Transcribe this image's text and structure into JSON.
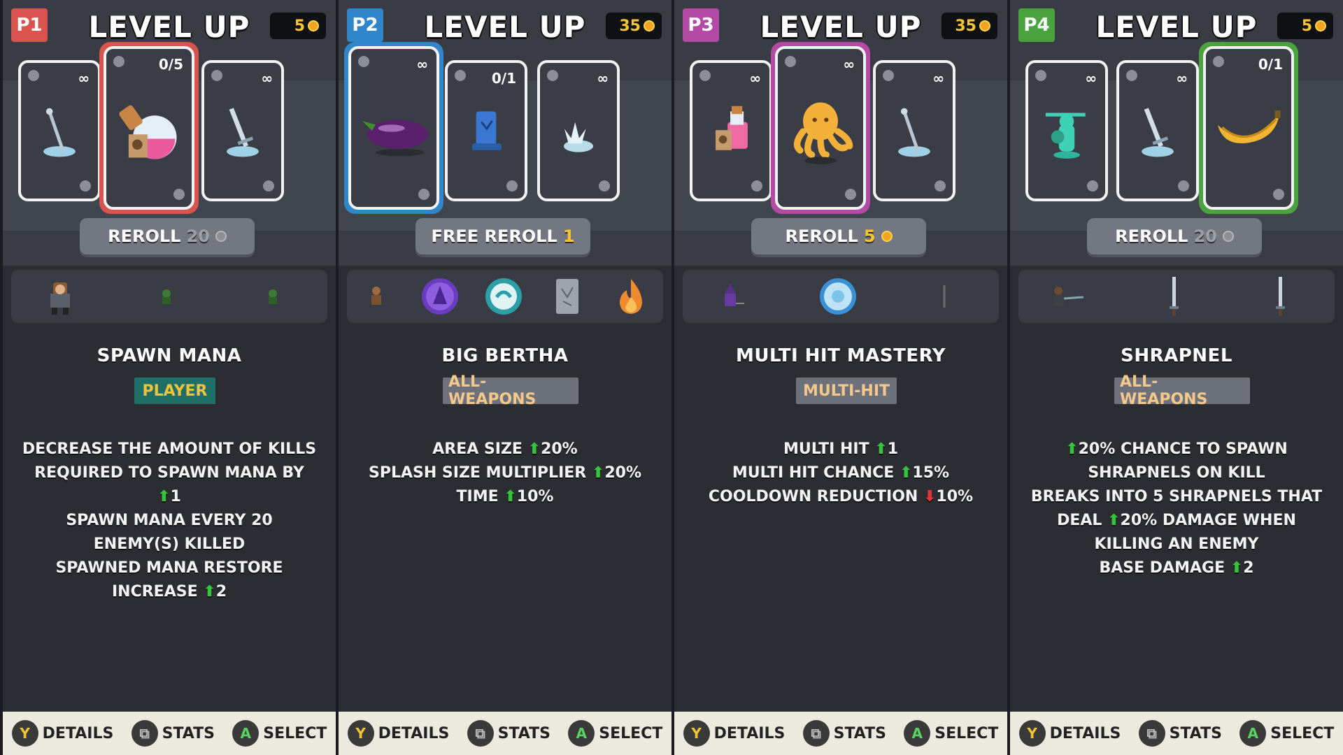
{
  "players": [
    {
      "badge": "P1",
      "badge_color": "#d9534f",
      "title": "LEVEL UP",
      "coins": "5",
      "cards": [
        {
          "qty": "∞",
          "icon": "staff-icon"
        },
        {
          "qty": "0/5",
          "icon": "mana-potion-icon",
          "selected": true
        },
        {
          "qty": "∞",
          "icon": "sword-icon"
        }
      ],
      "reroll_label": "REROLL",
      "reroll_cost": "20",
      "inventory": [
        "warrior-icon",
        "goblin-icon",
        "goblin-icon"
      ],
      "upgrade_name": "SPAWN MANA",
      "tag": "PLAYER",
      "tag_bg": "#1f6f68",
      "tag_color": "#f0c43a",
      "desc_lines": [
        "DECREASE THE AMOUNT OF KILLS",
        "REQUIRED TO SPAWN MANA BY",
        "↑1",
        "SPAWN MANA EVERY 20",
        "ENEMY(S) KILLED",
        "SPAWNED MANA RESTORE",
        "INCREASE ↑2"
      ],
      "hints": {
        "details": "DETAILS",
        "stats": "STATS",
        "select": "SELECT"
      }
    },
    {
      "badge": "P2",
      "badge_color": "#2f86c8",
      "title": "LEVEL UP",
      "coins": "35",
      "cards": [
        {
          "qty": "∞",
          "icon": "eggplant-icon",
          "selected": true
        },
        {
          "qty": "0/1",
          "icon": "blue-tome-icon"
        },
        {
          "qty": "∞",
          "icon": "splash-icon"
        }
      ],
      "reroll_label": "FREE REROLL",
      "reroll_cost": "1",
      "inventory": [
        "scarecrow-icon",
        "purple-orb-icon",
        "teal-orb-icon",
        "spellbook-icon",
        "flame-icon"
      ],
      "upgrade_name": "BIG BERTHA",
      "tag": "ALL-WEAPONS",
      "tag_bg": "#6d717c",
      "tag_color": "#f3c889",
      "desc_lines": [
        "AREA SIZE ↑20%",
        "SPLASH SIZE MULTIPLIER ↑20%",
        "TIME ↑10%"
      ],
      "hints": {
        "details": "DETAILS",
        "stats": "STATS",
        "select": "SELECT"
      }
    },
    {
      "badge": "P3",
      "badge_color": "#b24aa6",
      "title": "LEVEL UP",
      "coins": "35",
      "cards": [
        {
          "qty": "∞",
          "icon": "potion-icon"
        },
        {
          "qty": "∞",
          "icon": "octopus-icon",
          "selected": true
        },
        {
          "qty": "∞",
          "icon": "staff-icon"
        }
      ],
      "reroll_label": "REROLL",
      "reroll_cost": "5",
      "inventory": [
        "wizard-icon",
        "blue-orb-icon",
        "wand-icon"
      ],
      "upgrade_name": "MULTI HIT MASTERY",
      "tag": "MULTI-HIT",
      "tag_bg": "#6d717c",
      "tag_color": "#f3c889",
      "desc_lines": [
        "MULTI HIT ↑1",
        "MULTI HIT CHANCE ↑15%",
        "COOLDOWN REDUCTION ↓10%"
      ],
      "hints": {
        "details": "DETAILS",
        "stats": "STATS",
        "select": "SELECT"
      }
    },
    {
      "badge": "P4",
      "badge_color": "#4aa33f",
      "title": "LEVEL UP",
      "coins": "5",
      "cards": [
        {
          "qty": "∞",
          "icon": "knight-statue-icon"
        },
        {
          "qty": "∞",
          "icon": "sword-icon"
        },
        {
          "qty": "0/1",
          "icon": "banana-icon",
          "selected": true
        }
      ],
      "reroll_label": "REROLL",
      "reroll_cost": "20",
      "inventory": [
        "swordsman-icon",
        "blade-icon",
        "blade-icon"
      ],
      "upgrade_name": "SHRAPNEL",
      "tag": "ALL-WEAPONS",
      "tag_bg": "#6d717c",
      "tag_color": "#f3c889",
      "desc_lines": [
        "↑20% CHANCE TO SPAWN",
        "SHRAPNELS ON KILL",
        "BREAKS INTO 5 SHRAPNELS THAT",
        "DEAL ↑20% DAMAGE WHEN",
        "KILLING AN ENEMY",
        "BASE DAMAGE ↑2"
      ],
      "hints": {
        "details": "DETAILS",
        "stats": "STATS",
        "select": "SELECT"
      }
    }
  ]
}
